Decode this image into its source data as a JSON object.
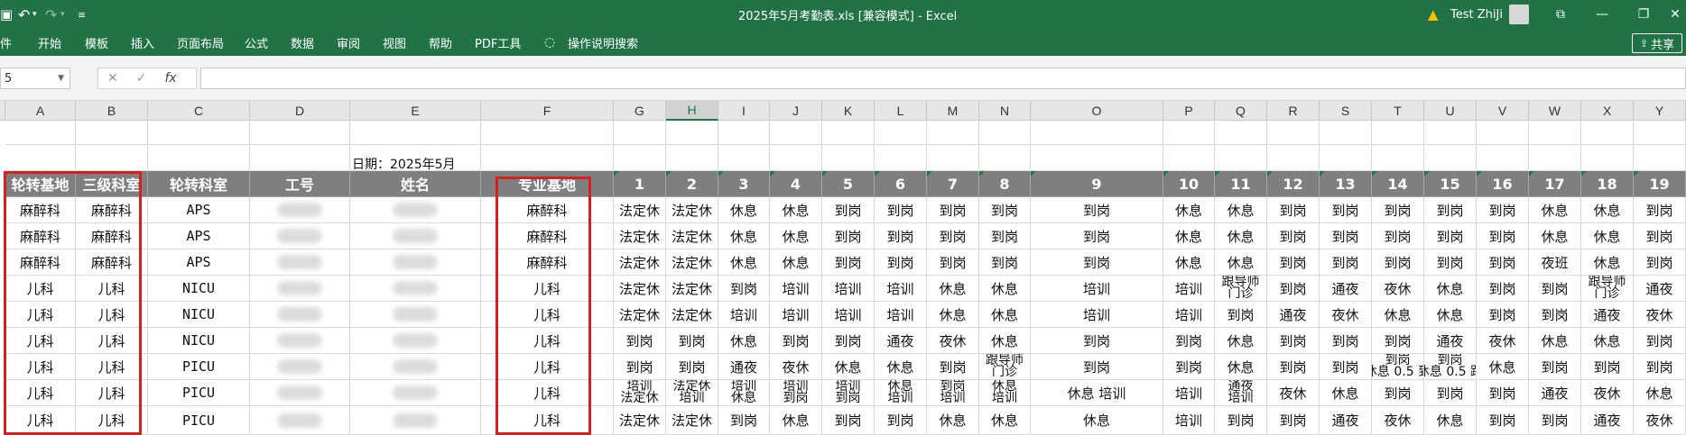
{
  "window": {
    "title": "2025年5月考勤表.xls  [兼容模式]  -  Excel",
    "user": "Test ZhiJi",
    "share_label": "共享"
  },
  "ribbon": {
    "tabs": [
      "件",
      "开始",
      "模板",
      "插入",
      "页面布局",
      "公式",
      "数据",
      "审阅",
      "视图",
      "帮助",
      "PDF工具"
    ],
    "tell_me": "操作说明搜索"
  },
  "formula_bar": {
    "name_box": "5",
    "formula": ""
  },
  "columns": [
    "A",
    "B",
    "C",
    "D",
    "E",
    "F",
    "G",
    "H",
    "I",
    "J",
    "K",
    "L",
    "M",
    "N",
    "O",
    "P",
    "Q",
    "R",
    "S",
    "T",
    "U",
    "V",
    "W",
    "X",
    "Y"
  ],
  "date_label": "日期：2025年5月",
  "header_row": [
    "轮转基地",
    "三级科室",
    "轮转科室",
    "工号",
    "姓名",
    "专业基地",
    "1",
    "2",
    "3",
    "4",
    "5",
    "6",
    "7",
    "8",
    "9",
    "10",
    "11",
    "12",
    "13",
    "14",
    "15",
    "16",
    "17",
    "18",
    "19"
  ],
  "rows": [
    [
      "麻醉科",
      "麻醉科",
      "APS",
      "",
      "",
      "麻醉科",
      "法定休",
      "法定休",
      "休息",
      "休息",
      "到岗",
      "到岗",
      "到岗",
      "到岗",
      "到岗",
      "休息",
      "休息",
      "到岗",
      "到岗",
      "到岗",
      "到岗",
      "到岗",
      "休息",
      "休息",
      "到岗"
    ],
    [
      "麻醉科",
      "麻醉科",
      "APS",
      "",
      "",
      "麻醉科",
      "法定休",
      "法定休",
      "休息",
      "休息",
      "到岗",
      "到岗",
      "到岗",
      "到岗",
      "到岗",
      "休息",
      "休息",
      "到岗",
      "到岗",
      "到岗",
      "到岗",
      "到岗",
      "休息",
      "休息",
      "到岗"
    ],
    [
      "麻醉科",
      "麻醉科",
      "APS",
      "",
      "",
      "麻醉科",
      "法定休",
      "法定休",
      "休息",
      "休息",
      "到岗",
      "到岗",
      "到岗",
      "到岗",
      "到岗",
      "休息",
      "休息",
      "到岗",
      "到岗",
      "到岗",
      "到岗",
      "到岗",
      "夜班",
      "休息",
      "到岗"
    ],
    [
      "儿科",
      "儿科",
      "NICU",
      "",
      "",
      "儿科",
      "法定休",
      "法定休",
      "到岗",
      "培训",
      "培训",
      "培训",
      "休息",
      "休息",
      "培训",
      "培训",
      "跟导师|门诊",
      "到岗",
      "通夜",
      "夜休",
      "休息",
      "到岗",
      "到岗",
      "跟导师|门诊",
      "通夜"
    ],
    [
      "儿科",
      "儿科",
      "NICU",
      "",
      "",
      "儿科",
      "法定休",
      "法定休",
      "培训",
      "培训",
      "培训",
      "培训",
      "休息",
      "休息",
      "培训",
      "培训",
      "到岗",
      "通夜",
      "夜休",
      "休息",
      "休息",
      "到岗",
      "到岗",
      "通夜",
      "夜休"
    ],
    [
      "儿科",
      "儿科",
      "NICU",
      "",
      "",
      "儿科",
      "到岗",
      "到岗",
      "休息",
      "到岗",
      "到岗",
      "通夜",
      "夜休",
      "休息",
      "到岗",
      "到岗",
      "休息",
      "到岗",
      "到岗",
      "到岗",
      "通夜",
      "夜休",
      "休息",
      "休息",
      "到岗"
    ],
    [
      "儿科",
      "儿科",
      "PICU",
      "",
      "",
      "儿科",
      "到岗",
      "到岗",
      "通夜",
      "夜休",
      "休息",
      "休息",
      "到岗",
      "跟导师|门诊",
      "到岗",
      "到岗",
      "休息",
      "到岗",
      "到岗",
      "到岗|休息 0.5 到",
      "到岗|休息 0.5 跟",
      "休息",
      "到岗",
      "到岗",
      "到岗"
    ],
    [
      "儿科",
      "儿科",
      "PICU",
      "",
      "",
      "儿科",
      "培训|法定休",
      "法定休|培训",
      "培训|休息",
      "培训|到岗",
      "培训|到岗",
      "休息|培训",
      "到岗|培训",
      "休息|培训",
      "休息  培训",
      "培训",
      "通夜|培训",
      "夜休",
      "休息",
      "到岗",
      "到岗",
      "到岗",
      "通夜",
      "夜休",
      "休息"
    ],
    [
      "儿科",
      "儿科",
      "PICU",
      "",
      "",
      "儿科",
      "法定休",
      "法定休",
      "到岗",
      "休息",
      "到岗",
      "到岗",
      "休息",
      "休息",
      "休息",
      "培训",
      "到岗",
      "到岗",
      "通夜",
      "夜休",
      "休息",
      "到岗",
      "到岗",
      "通夜",
      "夜休"
    ]
  ]
}
